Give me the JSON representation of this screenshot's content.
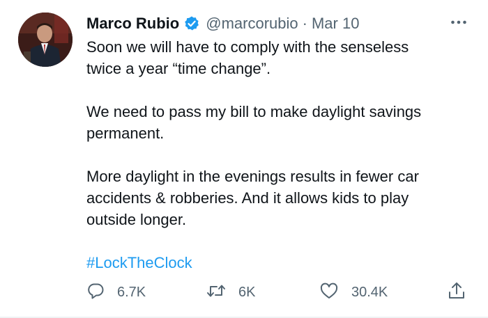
{
  "tweet": {
    "author_name": "Marco Rubio",
    "handle": "@marcorubio",
    "separator": "·",
    "date": "Mar 10",
    "verified": true,
    "paragraphs": [
      "Soon we will have to comply with the senseless\ntwice a year “time change”.",
      "We need to pass my bill to make daylight savings\npermanent.",
      "More daylight in the evenings results in fewer car\naccidents & robberies. And it allows kids to play\noutside longer."
    ],
    "hashtag": "#LockTheClock"
  },
  "actions": {
    "replies": "6.7K",
    "retweets": "6K",
    "likes": "30.4K"
  },
  "colors": {
    "text": "#0f1419",
    "secondary": "#536471",
    "accent": "#1d9bf0"
  },
  "icons": {
    "verified": "verified-badge-icon",
    "more": "more-horizontal-icon",
    "reply": "reply-icon",
    "retweet": "retweet-icon",
    "like": "heart-icon",
    "share": "share-icon"
  }
}
